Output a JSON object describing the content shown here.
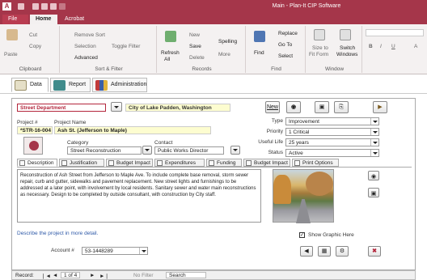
{
  "titlebar": {
    "title": "Main - Plan-It CIP Software",
    "app_icon": "A"
  },
  "ribbon_tabs": {
    "file": "File",
    "home": "Home",
    "acrobat": "Acrobat"
  },
  "ribbon": {
    "clipboard": {
      "label": "Clipboard",
      "paste": "Paste",
      "cut": "Cut",
      "copy": "Copy"
    },
    "sort_filter": {
      "label": "Sort & Filter",
      "remove_sort": "Remove Sort",
      "selection": "Selection",
      "advanced": "Advanced",
      "toggle_filter": "Toggle Filter"
    },
    "records": {
      "label": "Records",
      "refresh": "Refresh",
      "all": "All",
      "new": "New",
      "save": "Save",
      "delete": "Delete",
      "spelling": "Spelling",
      "more": "More"
    },
    "find": {
      "label": "Find",
      "find": "Find",
      "replace": "Replace",
      "goto": "Go To",
      "select": "Select"
    },
    "window": {
      "label": "Window",
      "size_to": "Size to",
      "fit_form": "Fit Form",
      "switch": "Switch",
      "windows": "Windows"
    },
    "text_format": {
      "b": "B",
      "i": "I",
      "u": "U",
      "a": "A"
    }
  },
  "nav_tabs": [
    "Data",
    "Report",
    "Administration"
  ],
  "form": {
    "department": "Street Department",
    "city": "City of Lake Padden, Washington",
    "new_button": "New",
    "project_num_label": "Project #",
    "project_name_label": "Project Name",
    "project_num": "*STR-16-004",
    "project_name": "Ash St. (Jefferson to Maple)",
    "category_label": "Category",
    "category": "Street Reconstruction",
    "contact_label": "Contact",
    "contact": "Public Works Director",
    "type_label": "Type",
    "type": "Improvement",
    "priority_label": "Priority",
    "priority": "1 Critical",
    "useful_life_label": "Useful Life",
    "useful_life": "25 years",
    "status_label": "Status",
    "status": "Active",
    "subtabs": [
      "Description",
      "Justification",
      "Budget Impact",
      "Expenditures",
      "Funding",
      "Budget Impact",
      "Print Options"
    ],
    "description": "Reconstruction of Ash Street from Jefferson to Maple Ave. To include complete base removal, storm sewer repair, curb and gutter, sidewalks and pavement replacement. New street lights and furnishings to be addressed at a later point, with involvement by local residents. Sanitary sewer and water main reconstructions as necessary. Design to be completed by outside consultant, with construction by City staff.",
    "describe_hint": "Describe the project in more detail.",
    "account_label": "Account #",
    "account": "53-1448289",
    "show_graphic": "Show Graphic Here"
  },
  "statusbar": {
    "record_label": "Record:",
    "nav_first": "❘◄",
    "nav_prev": "◄",
    "position": "1 of 4",
    "nav_next": "►",
    "nav_last": "►❘",
    "no_filter": "No Filter",
    "search": "Search"
  },
  "colors": {
    "accent": "#a5364a",
    "department": "#b3263c",
    "highlight": "#fdfdd0"
  }
}
